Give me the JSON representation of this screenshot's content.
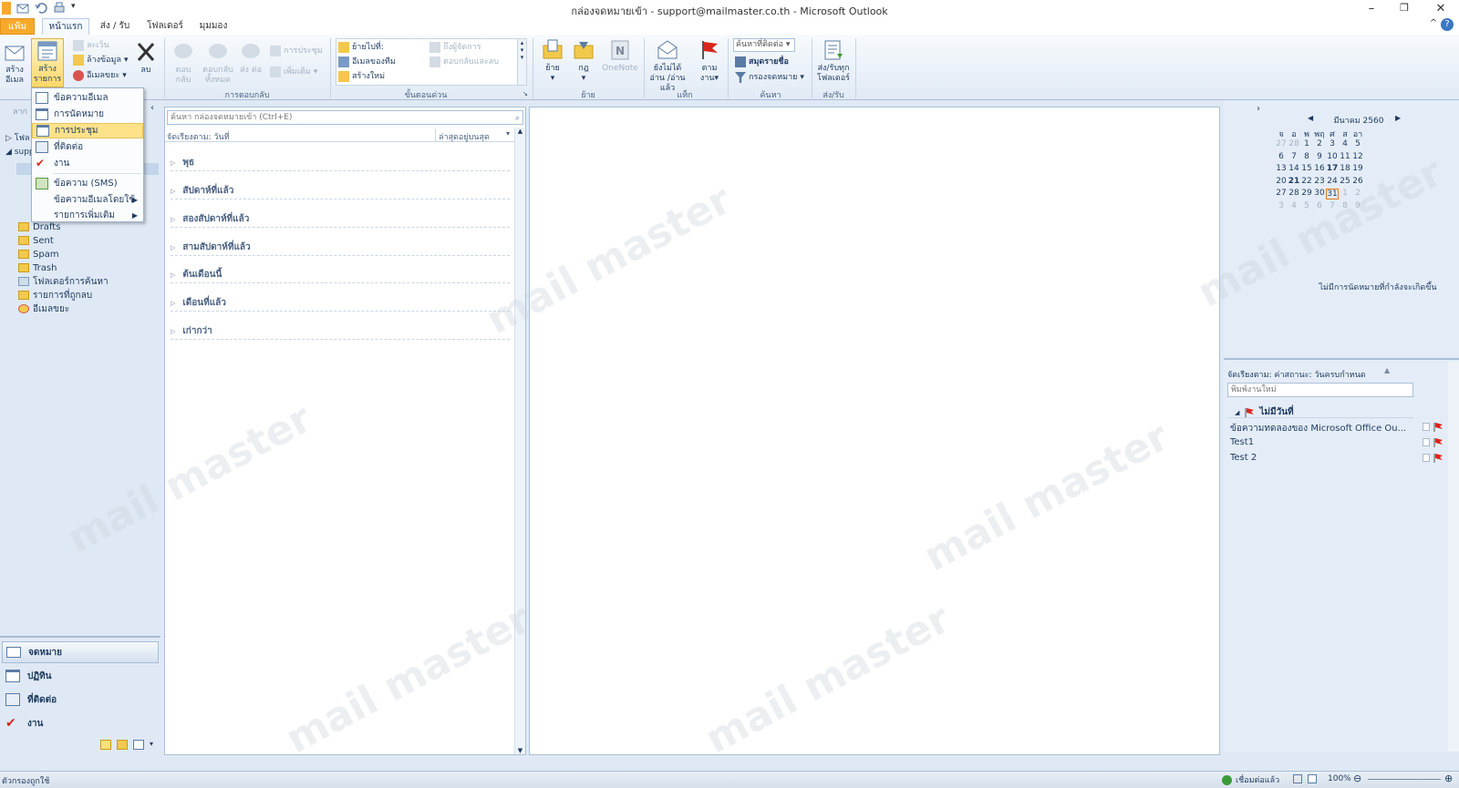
{
  "window": {
    "title": "กล่องจดหมายเข้า - support@mailmaster.co.th - Microsoft Outlook"
  },
  "tabs": [
    "แฟ้ม",
    "หน้าแรก",
    "ส่ง / รับ",
    "โฟลเดอร์",
    "มุมมอง"
  ],
  "ribbon": {
    "new_email": "สร้าง อีเมล",
    "new_items": "สร้าง รายการ",
    "ignore": "ละเว้น",
    "cleanup": "ล้างข้อมูล",
    "junk": "อีเมลขยะ",
    "delete": "ลบ",
    "reply": "ตอบ กลับ",
    "reply_all": "ตอบกลับ ทั้งหมด",
    "forward": "ส่ง ต่อ",
    "meeting": "การประชุม",
    "more": "เพิ่มเติม",
    "group_respond": "การตอบกลับ",
    "qs_move": "ย้ายไปที่:",
    "qs_team": "อีเมลของทีม",
    "qs_new": "สร้างใหม่",
    "qs_manager": "ถึงผู้จัดการ",
    "qs_replydel": "ตอบกลับและลบ",
    "group_quicksteps": "ขั้นตอนด่วน",
    "move": "ย้าย",
    "rules": "กฎ",
    "onenote": "OneNote",
    "group_move": "ย้าย",
    "unread": "ยังไม่ได้อ่าน /อ่านแล้ว",
    "followup": "ตาม งาน",
    "group_tags": "แท็ก",
    "find_contact": "ค้นหาที่ติดต่อ",
    "address_book": "สมุดรายชื่อ",
    "filter_email": "กรองจดหมาย",
    "group_find": "ค้นหา",
    "send_receive": "ส่ง/รับทุก โฟลเดอร์",
    "group_sendreceive": "ส่ง/รับ"
  },
  "menu": {
    "items": [
      "ข้อความอีเมล",
      "การนัดหมาย",
      "การประชุม",
      "ที่ติดต่อ",
      "งาน",
      "ข้อความ (SMS)",
      "ข้อความอีเมลโดยใช้",
      "รายการเพิ่มเติม"
    ],
    "highlighted": "การประชุม"
  },
  "nav": {
    "favorites_partial": "ลาก",
    "favorites_folder": "โฟล",
    "account_partial": "supp",
    "folders": [
      "Drafts",
      "Sent",
      "Spam",
      "Trash",
      "โฟลเดอร์การค้นหา",
      "รายการที่ถูกลบ",
      "อีเมลขยะ"
    ],
    "modules": [
      "จดหมาย",
      "ปฏิทิน",
      "ที่ติดต่อ",
      "งาน"
    ]
  },
  "list": {
    "search_placeholder": "ค้นหา กล่องจดหมายเข้า (Ctrl+E)",
    "arrange_by": "จัดเรียงตาม: วันที่",
    "sort_order": "ล่าสุดอยู่บนสุด",
    "groups": [
      "พุธ",
      "สัปดาห์ที่แล้ว",
      "สองสัปดาห์ที่แล้ว",
      "สามสัปดาห์ที่แล้ว",
      "ต้นเดือนนี้",
      "เดือนที่แล้ว",
      "เก่ากว่า"
    ]
  },
  "todo": {
    "month": "มีนาคม 2560",
    "weekdays": [
      "จ",
      "อ",
      "พ",
      "พฤ",
      "ศ",
      "ส",
      "อา"
    ],
    "weeks": [
      [
        "27",
        "28",
        "1",
        "2",
        "3",
        "4",
        "5"
      ],
      [
        "6",
        "7",
        "8",
        "9",
        "10",
        "11",
        "12"
      ],
      [
        "13",
        "14",
        "15",
        "16",
        "17",
        "18",
        "19"
      ],
      [
        "20",
        "21",
        "22",
        "23",
        "24",
        "25",
        "26"
      ],
      [
        "27",
        "28",
        "29",
        "30",
        "31",
        "1",
        "2"
      ],
      [
        "3",
        "4",
        "5",
        "6",
        "7",
        "8",
        "9"
      ]
    ],
    "no_appointments": "ไม่มีการนัดหมายที่กำลังจะเกิดขึ้น",
    "arrange": "จัดเรียงตาม: ค่าสถานะ: วันครบกำหนด",
    "new_task_placeholder": "พิมพ์งานใหม่",
    "group_label": "ไม่มีวันที่",
    "tasks": [
      "ข้อความทดลองของ Microsoft Office Ou...",
      "Test1",
      "Test 2"
    ]
  },
  "status": {
    "left": "ตัวกรองถูกใช้",
    "connection": "เชื่อมต่อแล้ว",
    "zoom": "100%"
  },
  "watermark": "mail master"
}
